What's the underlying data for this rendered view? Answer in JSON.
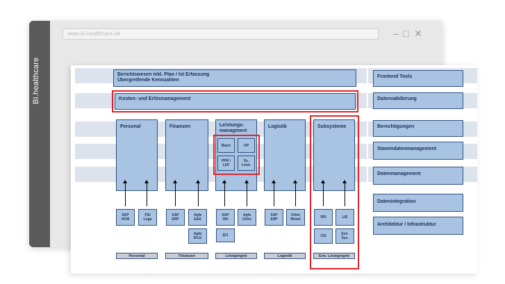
{
  "brand": "BI.healthcare",
  "url": "www.bi-healthcare.de",
  "window": {
    "minimize": "–",
    "maximize": "□",
    "close": "✕"
  },
  "top_box": {
    "line1": "Berichtswesen inkl. Plan / Ist Erfassung",
    "line2": "Übergreifende Kennzahlen"
  },
  "kosten": "Kosten- und Erlösmanagement",
  "columns": [
    {
      "title": "Personal",
      "footer": "Personal"
    },
    {
      "title": "Finanzen",
      "footer": "Finanzen"
    },
    {
      "title": "Leistungs-\nmanagment",
      "footer": "Leistgmgmt"
    },
    {
      "title": "Logistik",
      "footer": "Logistik"
    },
    {
      "title": "Subsysteme",
      "footer": "Erw. Leistgmgmt"
    }
  ],
  "leistung_inner": [
    "Basis",
    "OP",
    "PPR /\nLEP",
    "Ss.\nLeist."
  ],
  "sources": {
    "personal": [
      "SAP\nHCM",
      "P&I\nLoga"
    ],
    "finanzen": [
      "SAP\nERP",
      "Agfa\nE&S",
      "Agfa\nIKLE"
    ],
    "leistung": [
      "SAP\nISH",
      "Agfa\nOrbis",
      "§21"
    ],
    "logistik": [
      "SAP\nERP",
      "Orbis\nMosel"
    ],
    "subsysteme": [
      "RIS",
      "LIS",
      "CIS",
      "Son.\nSys."
    ]
  },
  "right": [
    "Frontend Tools",
    "Datenvalidierung",
    "Berechtigungen",
    "Stammdatenmanagement",
    "Datenmanagement",
    "Datenintegration",
    "Architektur / Infrastruktur"
  ],
  "colors": {
    "box": "#a9c4e2",
    "border": "#2f4f7f",
    "band": "#dde3ec",
    "highlight": "#e0242b"
  }
}
